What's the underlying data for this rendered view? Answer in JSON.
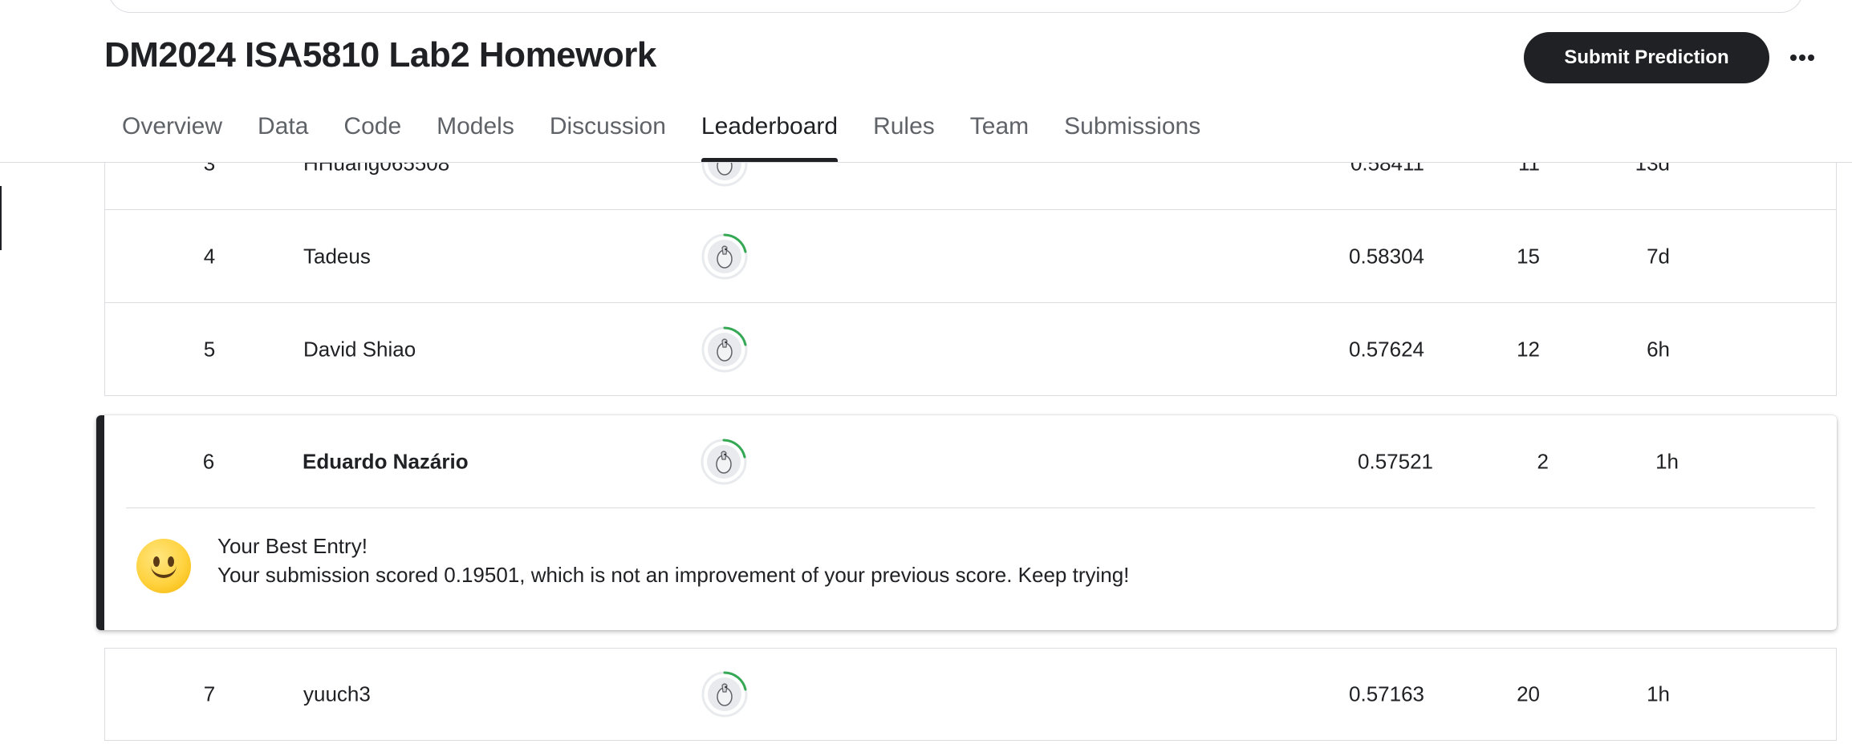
{
  "header": {
    "title": "DM2024 ISA5810 Lab2 Homework",
    "submit_label": "Submit Prediction",
    "more_label": "•••"
  },
  "tabs": [
    {
      "label": "Overview",
      "active": false
    },
    {
      "label": "Data",
      "active": false
    },
    {
      "label": "Code",
      "active": false
    },
    {
      "label": "Models",
      "active": false
    },
    {
      "label": "Discussion",
      "active": false
    },
    {
      "label": "Leaderboard",
      "active": true
    },
    {
      "label": "Rules",
      "active": false
    },
    {
      "label": "Team",
      "active": false
    },
    {
      "label": "Submissions",
      "active": false
    }
  ],
  "rows": [
    {
      "rank": "3",
      "name": "HHuang065508",
      "score": "0.58411",
      "entries": "11",
      "last": "13d"
    },
    {
      "rank": "4",
      "name": "Tadeus",
      "score": "0.58304",
      "entries": "15",
      "last": "7d"
    },
    {
      "rank": "5",
      "name": "David Shiao",
      "score": "0.57624",
      "entries": "12",
      "last": "6h"
    },
    {
      "rank": "7",
      "name": "yuuch3",
      "score": "0.57163",
      "entries": "20",
      "last": "1h"
    }
  ],
  "highlight": {
    "rank": "6",
    "name": "Eduardo Nazário",
    "score": "0.57521",
    "entries": "2",
    "last": "1h",
    "message_title": "Your Best Entry!",
    "message_body": "Your submission scored 0.19501, which is not an improvement of your previous score. Keep trying!"
  },
  "colors": {
    "accent": "#202124",
    "progress_ring": "#20beff",
    "progress_green": "#34a853"
  },
  "icons": {
    "more": "more-horizontal-icon",
    "avatar": "user-avatar-icon",
    "smiley": "smiley-face-icon"
  }
}
